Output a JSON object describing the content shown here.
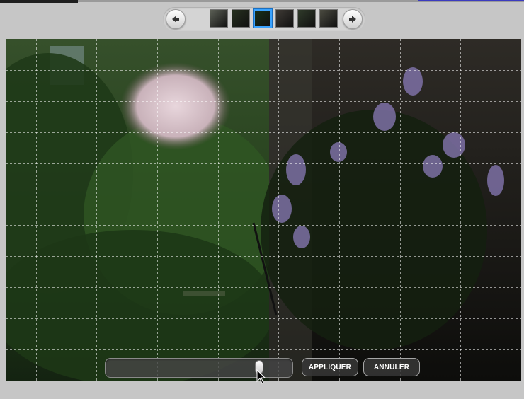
{
  "actions": {
    "apply_label": "APPLIQUER",
    "cancel_label": "ANNULER"
  },
  "filmstrip": {
    "thumbnails": [
      {
        "color": "#5b5f55",
        "selected": false
      },
      {
        "color": "#26301f",
        "selected": false
      },
      {
        "color": "#173019",
        "selected": true
      },
      {
        "color": "#3e3a35",
        "selected": false
      },
      {
        "color": "#2f3a2a",
        "selected": false
      },
      {
        "color": "#4a4a40",
        "selected": false
      }
    ]
  },
  "slider": {
    "value": 0.85
  },
  "icons": {
    "prev": "arrow-left-icon",
    "next": "arrow-right-icon",
    "cursor": "mouse-pointer-icon"
  },
  "photo": {
    "grid_columns": 17,
    "grid_rows": 11,
    "grid_color": "#ffffff"
  }
}
